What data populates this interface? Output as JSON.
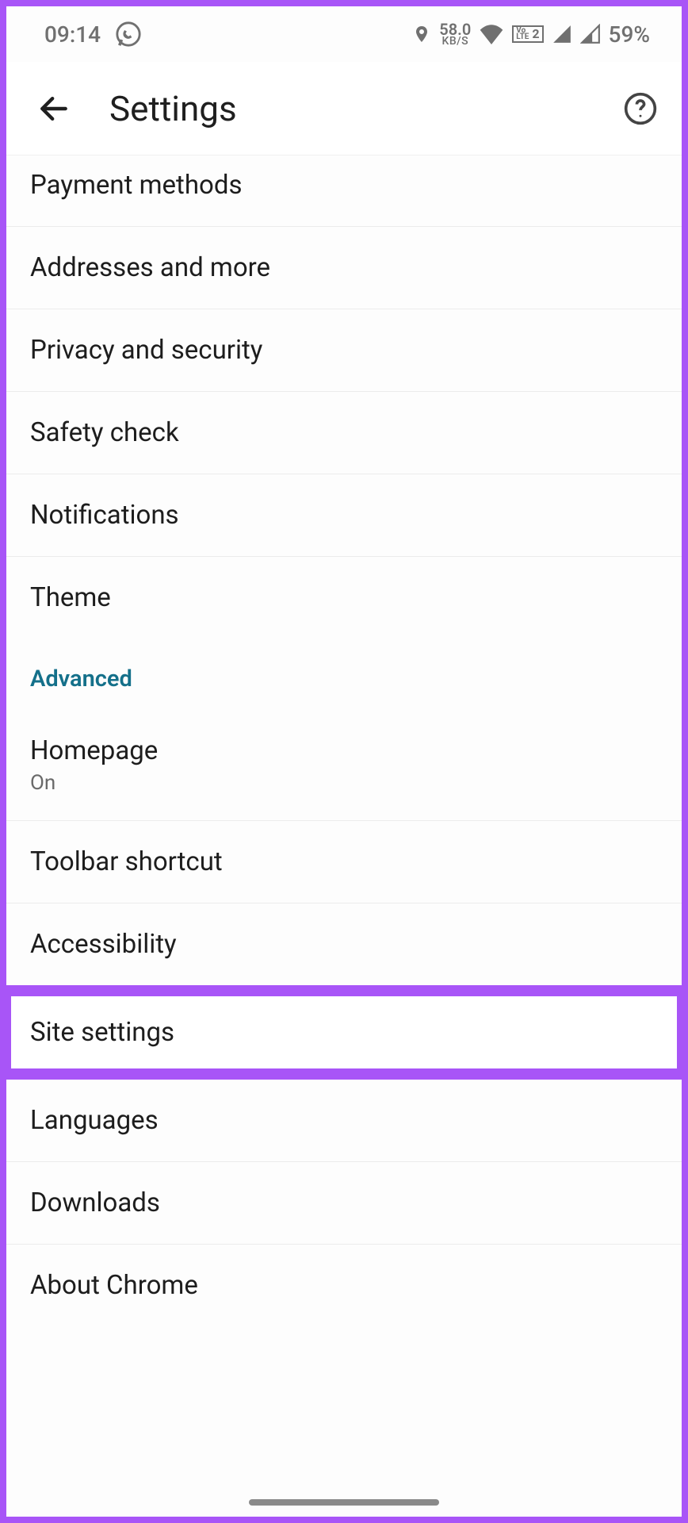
{
  "status": {
    "time": "09:14",
    "net_speed_top": "58.0",
    "net_speed_bot": "KB/S",
    "battery": "59%"
  },
  "header": {
    "title": "Settings"
  },
  "section_advanced": "Advanced",
  "items": {
    "payment": "Payment methods",
    "addresses": "Addresses and more",
    "privacy": "Privacy and security",
    "safety": "Safety check",
    "notifications": "Notifications",
    "theme": "Theme",
    "homepage": "Homepage",
    "homepage_sub": "On",
    "toolbar": "Toolbar shortcut",
    "accessibility": "Accessibility",
    "site": "Site settings",
    "languages": "Languages",
    "downloads": "Downloads",
    "about": "About Chrome"
  }
}
